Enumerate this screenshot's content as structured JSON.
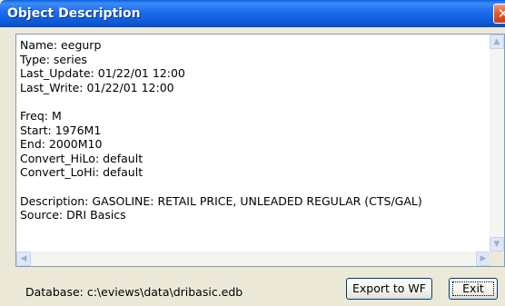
{
  "window": {
    "title": "Object Description",
    "close_glyph": "✕"
  },
  "description": {
    "lines": [
      "Name: eegurp",
      "Type: series",
      "Last_Update: 01/22/01 12:00",
      "Last_Write: 01/22/01 12:00",
      "",
      "Freq: M",
      "Start: 1976M1",
      "End: 2000M10",
      "Convert_HiLo: default",
      "Convert_LoHi: default",
      "",
      "Description: GASOLINE: RETAIL PRICE, UNLEADED REGULAR (CTS/GAL)",
      "Source: DRI Basics"
    ]
  },
  "scrollbars": {
    "up_glyph": "▲",
    "down_glyph": "▼",
    "left_glyph": "◀",
    "right_glyph": "▶"
  },
  "status": {
    "database": "Database: c:\\eviews\\data\\dribasic.edb"
  },
  "buttons": {
    "export": "Export to WF",
    "exit": "Exit"
  }
}
